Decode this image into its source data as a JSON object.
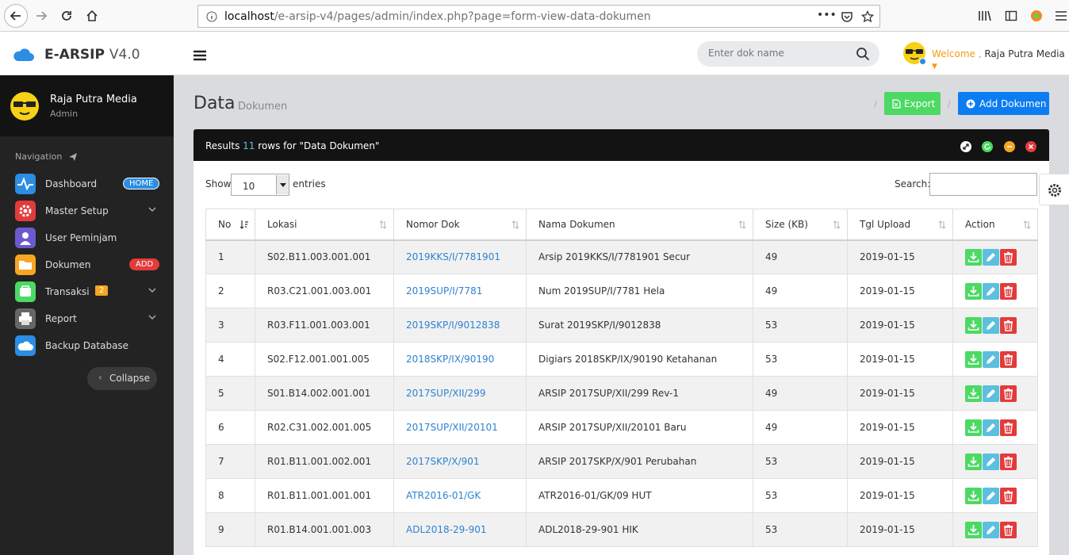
{
  "browser": {
    "url_host": "localhost",
    "url_path": "/e-arsip-v4/pages/admin/index.php?page=form-view-data-dokumen"
  },
  "app": {
    "name": "E-ARSIP",
    "version": "V4.0",
    "search_placeholder": "Enter dok name",
    "welcome": "Welcome ,",
    "user": "Raja Putra Media"
  },
  "sidebar": {
    "profile_name": "Raja Putra Media",
    "profile_role": "Admin",
    "nav_heading": "Navigation",
    "items": [
      {
        "label": "Dashboard",
        "badge": "HOME",
        "icon": "pulse-icon",
        "color": "#2b8de3"
      },
      {
        "label": "Master Setup",
        "icon": "gear-icon",
        "color": "#e33b3b"
      },
      {
        "label": "User Peminjam",
        "icon": "user-icon",
        "color": "#6a5acd"
      },
      {
        "label": "Dokumen",
        "badge": "ADD",
        "icon": "folder-icon",
        "color": "#f5a623"
      },
      {
        "label": "Transaksi",
        "badge": "2",
        "icon": "cart-icon",
        "color": "#4cd964"
      },
      {
        "label": "Report",
        "icon": "printer-icon",
        "color": "#666666"
      },
      {
        "label": "Backup Database",
        "icon": "cloud-icon",
        "color": "#2b8de3"
      }
    ],
    "collapse_label": "Collapse"
  },
  "page": {
    "title": "Data",
    "subtitle": "Dokumen",
    "export_label": "Export",
    "add_label": "Add Dokumen",
    "results_prefix": "Results",
    "results_count": "11",
    "results_suffix": "rows for \"Data Dokumen\"",
    "show_label": "Show",
    "page_length": "10",
    "entries_label": "entries",
    "search_label": "Search:"
  },
  "table": {
    "columns": [
      "No",
      "Lokasi",
      "Nomor Dok",
      "Nama Dokumen",
      "Size (KB)",
      "Tgl Upload",
      "Action"
    ],
    "rows": [
      {
        "no": "1",
        "lokasi": "S02.B11.003.001.001",
        "nomor": "2019KKS/I/7781901",
        "nama": "Arsip 2019KKS/I/7781901 Secur",
        "size": "49",
        "tgl": "2019-01-15"
      },
      {
        "no": "2",
        "lokasi": "R03.C21.001.003.001",
        "nomor": "2019SUP/I/7781",
        "nama": "Num 2019SUP/I/7781 Hela",
        "size": "49",
        "tgl": "2019-01-15"
      },
      {
        "no": "3",
        "lokasi": "R03.F11.001.003.001",
        "nomor": "2019SKP/I/9012838",
        "nama": "Surat 2019SKP/I/9012838",
        "size": "53",
        "tgl": "2019-01-15"
      },
      {
        "no": "4",
        "lokasi": "S02.F12.001.001.005",
        "nomor": "2018SKP/IX/90190",
        "nama": "Digiars 2018SKP/IX/90190 Ketahanan",
        "size": "53",
        "tgl": "2019-01-15"
      },
      {
        "no": "5",
        "lokasi": "S01.B14.002.001.001",
        "nomor": "2017SUP/XII/299",
        "nama": "ARSIP 2017SUP/XII/299 Rev-1",
        "size": "49",
        "tgl": "2019-01-15"
      },
      {
        "no": "6",
        "lokasi": "R02.C31.002.001.005",
        "nomor": "2017SUP/XII/20101",
        "nama": "ARSIP 2017SUP/XII/20101 Baru",
        "size": "49",
        "tgl": "2019-01-15"
      },
      {
        "no": "7",
        "lokasi": "R01.B11.001.002.001",
        "nomor": "2017SKP/X/901",
        "nama": "ARSIP 2017SKP/X/901 Perubahan",
        "size": "53",
        "tgl": "2019-01-15"
      },
      {
        "no": "8",
        "lokasi": "R01.B11.001.001.001",
        "nomor": "ATR2016-01/GK",
        "nama": "ATR2016-01/GK/09 HUT",
        "size": "53",
        "tgl": "2019-01-15"
      },
      {
        "no": "9",
        "lokasi": "R01.B14.001.001.003",
        "nomor": "ADL2018-29-901",
        "nama": "ADL2018-29-901 HIK",
        "size": "53",
        "tgl": "2019-01-15"
      }
    ]
  }
}
